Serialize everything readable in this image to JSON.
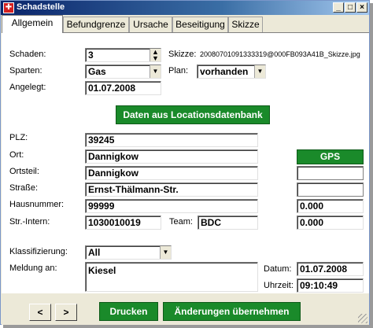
{
  "window": {
    "title": "Schadstelle",
    "icon": "app-icon",
    "buttons": [
      "_",
      "□",
      "×"
    ]
  },
  "tabs": [
    "Allgemein",
    "Befundgrenze",
    "Ursache",
    "Beseitigung",
    "Skizze"
  ],
  "form": {
    "schaden_label": "Schaden:",
    "schaden_value": "3",
    "skizze_label": "Skizze:",
    "skizze_value": "20080701091333319@000FB093A41B_Skizze.jpg",
    "sparten_label": "Sparten:",
    "sparten_value": "Gas",
    "plan_label": "Plan:",
    "plan_value": "vorhanden",
    "angelegt_label": "Angelegt:",
    "angelegt_value": "01.07.2008",
    "loc_button": "Daten aus Locationsdatenbank",
    "plz_label": "PLZ:",
    "plz_value": "39245",
    "ort_label": "Ort:",
    "ort_value": "Dannigkow",
    "ortsteil_label": "Ortsteil:",
    "ortsteil_value": "Dannigkow",
    "strasse_label": "Straße:",
    "strasse_value": "Ernst-Thälmann-Str.",
    "hausnummer_label": "Hausnummer:",
    "hausnummer_value": "99999",
    "strintern_label": "Str.-Intern:",
    "strintern_value": "1030010019",
    "team_label": "Team:",
    "team_value": "BDC",
    "gps_button": "GPS",
    "gps_x": "0.000",
    "gps_y": "0.000",
    "klass_label": "Klassifizierung:",
    "klass_value": "All",
    "meldung_label": "Meldung an:",
    "meldung_value": "Kiesel",
    "datum_label": "Datum:",
    "datum_value": "01.07.2008",
    "uhrzeit_label": "Uhrzeit:",
    "uhrzeit_value": "09:10:49"
  },
  "footer": {
    "prev": "<",
    "next": ">",
    "print": "Drucken",
    "apply": "Änderungen übernehmen"
  }
}
